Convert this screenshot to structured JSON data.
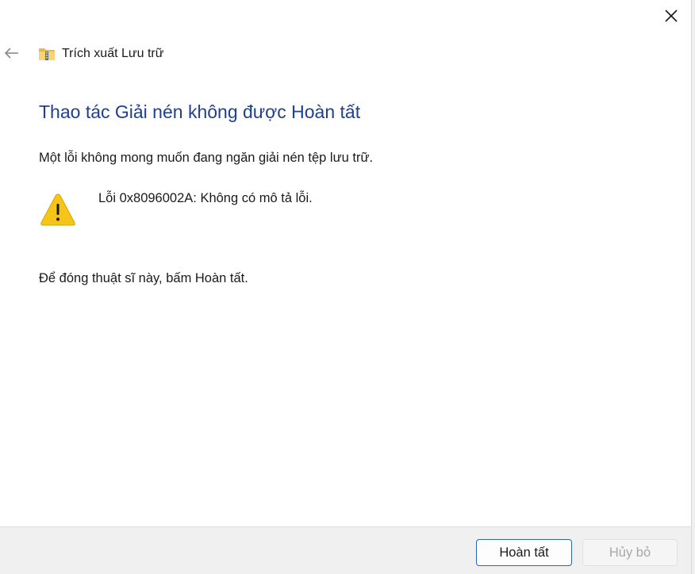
{
  "header": {
    "title": "Trích xuất Lưu trữ",
    "folder_icon": "zipped-folder-icon"
  },
  "nav": {
    "back_icon": "back-arrow-icon",
    "close_icon": "close-icon"
  },
  "content": {
    "heading": "Thao tác Giải nén không được Hoàn tất",
    "intro": "Một lỗi không mong muốn đang ngăn giải nén tệp lưu trữ.",
    "error_message": "Lỗi 0x8096002A: Không có mô tả lỗi.",
    "warning_icon": "warning-triangle-icon",
    "finish_instruction": "Để đóng thuật sĩ này, bấm Hoàn tất."
  },
  "footer": {
    "finish_label": "Hoàn tất",
    "cancel_label": "Hủy bỏ",
    "cancel_enabled": false
  },
  "colors": {
    "heading": "#1f3f8f",
    "warning": "#f5c518",
    "primary_border": "#2a63b8",
    "footer_bg": "#f0f0f0"
  }
}
